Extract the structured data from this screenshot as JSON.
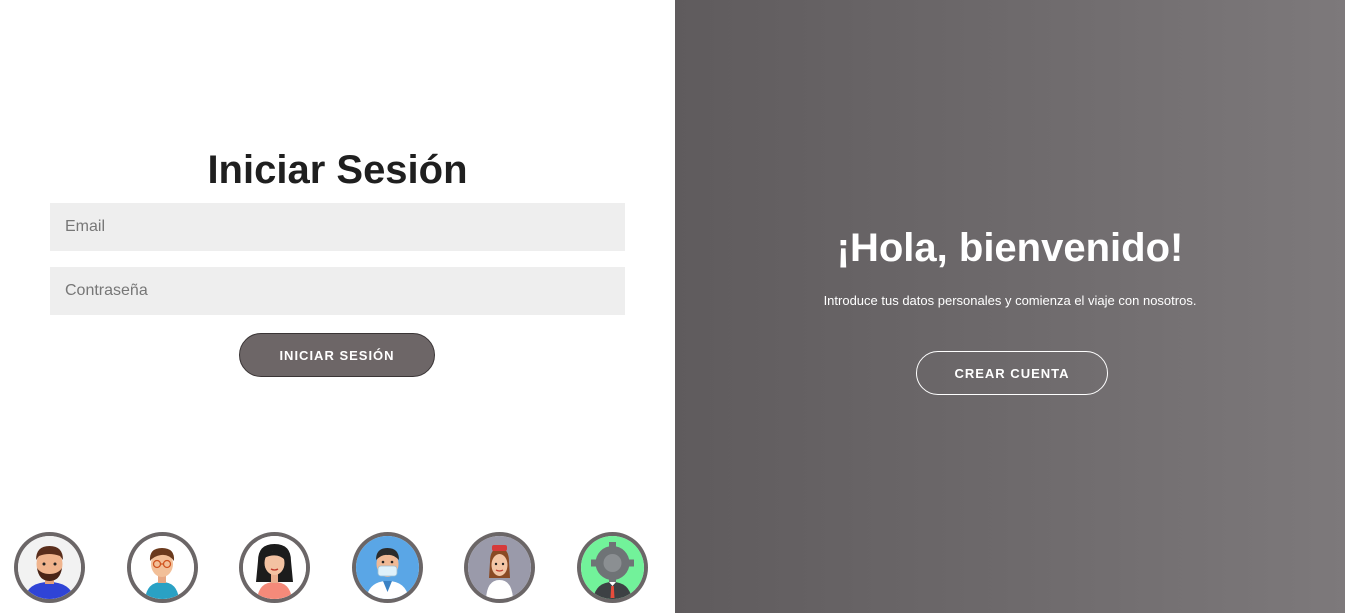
{
  "login": {
    "title": "Iniciar Sesión",
    "email_placeholder": "Email",
    "password_placeholder": "Contraseña",
    "submit_label": "INICIAR SESIÓN"
  },
  "welcome": {
    "title": "¡Hola, bienvenido!",
    "text": "Introduce tus datos personales y comienza el viaje con nosotros.",
    "create_label": "CREAR CUENTA"
  },
  "avatars": [
    {
      "icon": "bearded-man-avatar-icon"
    },
    {
      "icon": "boy-glasses-avatar-icon"
    },
    {
      "icon": "woman-avatar-icon"
    },
    {
      "icon": "doctor-mask-avatar-icon"
    },
    {
      "icon": "nurse-avatar-icon"
    },
    {
      "icon": "gear-head-avatar-icon"
    }
  ],
  "colors": {
    "button": "#6d6667",
    "input_bg": "#eeeeee",
    "panel_dark": "#5f5b5d",
    "panel_light": "#7d797b"
  }
}
